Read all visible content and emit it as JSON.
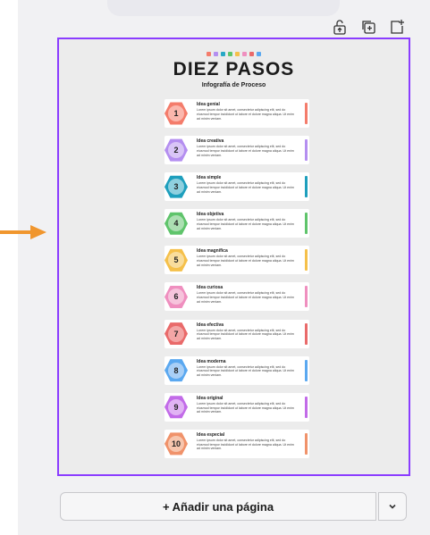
{
  "document": {
    "title": "DIEZ PASOS",
    "subtitle": "Infografía de Proceso",
    "dots": [
      "#f47c6b",
      "#b48ef0",
      "#27a8c5",
      "#5fc46b",
      "#f5c04a",
      "#ef8fbf",
      "#e96a6a",
      "#5aa8f0"
    ],
    "steps": [
      {
        "number": "1",
        "title": "Idea genial",
        "body": "Lorem ipsum dolor sit amet, consectetur adipiscing elit, sed do eiusmod tempor incididunt ut labore et dolore magna aliqua. Ut enim ad minim veniam.",
        "color": "#f47c6b",
        "light": "#fbb7ad"
      },
      {
        "number": "2",
        "title": "Idea creativa",
        "body": "Lorem ipsum dolor sit amet, consectetur adipiscing elit, sed do eiusmod tempor incididunt ut labore et dolore magna aliqua. Ut enim ad minim veniam.",
        "color": "#b48ef0",
        "light": "#d9c5f7"
      },
      {
        "number": "3",
        "title": "Idea simple",
        "body": "Lorem ipsum dolor sit amet, consectetur adipiscing elit, sed do eiusmod tempor incididunt ut labore et dolore magna aliqua. Ut enim ad minim veniam.",
        "color": "#1e9fbd",
        "light": "#8fd0df"
      },
      {
        "number": "4",
        "title": "Idea objetiva",
        "body": "Lorem ipsum dolor sit amet, consectetur adipiscing elit, sed do eiusmod tempor incididunt ut labore et dolore magna aliqua. Ut enim ad minim veniam.",
        "color": "#5fc46b",
        "light": "#acdfb2"
      },
      {
        "number": "5",
        "title": "Idea magnífica",
        "body": "Lorem ipsum dolor sit amet, consectetur adipiscing elit, sed do eiusmod tempor incididunt ut labore et dolore magna aliqua. Ut enim ad minim veniam.",
        "color": "#f5c04a",
        "light": "#f9dd9c"
      },
      {
        "number": "6",
        "title": "Idea curiosa",
        "body": "Lorem ipsum dolor sit amet, consectetur adipiscing elit, sed do eiusmod tempor incididunt ut labore et dolore magna aliqua. Ut enim ad minim veniam.",
        "color": "#ef8fbf",
        "light": "#f6c4dc"
      },
      {
        "number": "7",
        "title": "Idea efectiva",
        "body": "Lorem ipsum dolor sit amet, consectetur adipiscing elit, sed do eiusmod tempor incididunt ut labore et dolore magna aliqua. Ut enim ad minim veniam.",
        "color": "#e96a6a",
        "light": "#f3a6a6"
      },
      {
        "number": "8",
        "title": "Idea moderna",
        "body": "Lorem ipsum dolor sit amet, consectetur adipiscing elit, sed do eiusmod tempor incididunt ut labore et dolore magna aliqua. Ut enim ad minim veniam.",
        "color": "#5aa8f0",
        "light": "#a9cff6"
      },
      {
        "number": "9",
        "title": "Idea original",
        "body": "Lorem ipsum dolor sit amet, consectetur adipiscing elit, sed do eiusmod tempor incididunt ut labore et dolore magna aliqua. Ut enim ad minim veniam.",
        "color": "#c26be8",
        "light": "#e1b3f4"
      },
      {
        "number": "10",
        "title": "Idea especial",
        "body": "Lorem ipsum dolor sit amet, consectetur adipiscing elit, sed do eiusmod tempor incididunt ut labore et dolore magna aliqua. Ut enim ad minim veniam.",
        "color": "#f0926a",
        "light": "#f7c6ae"
      }
    ]
  },
  "toolbar": {
    "icons": [
      "lock-icon",
      "duplicate-page-icon",
      "add-page-icon"
    ]
  },
  "footer": {
    "add_page_label": "+ Añadir una página",
    "more_icon": "chevron-down-icon"
  },
  "colors": {
    "selection": "#8b3dff",
    "arrow": "#f0962e"
  }
}
